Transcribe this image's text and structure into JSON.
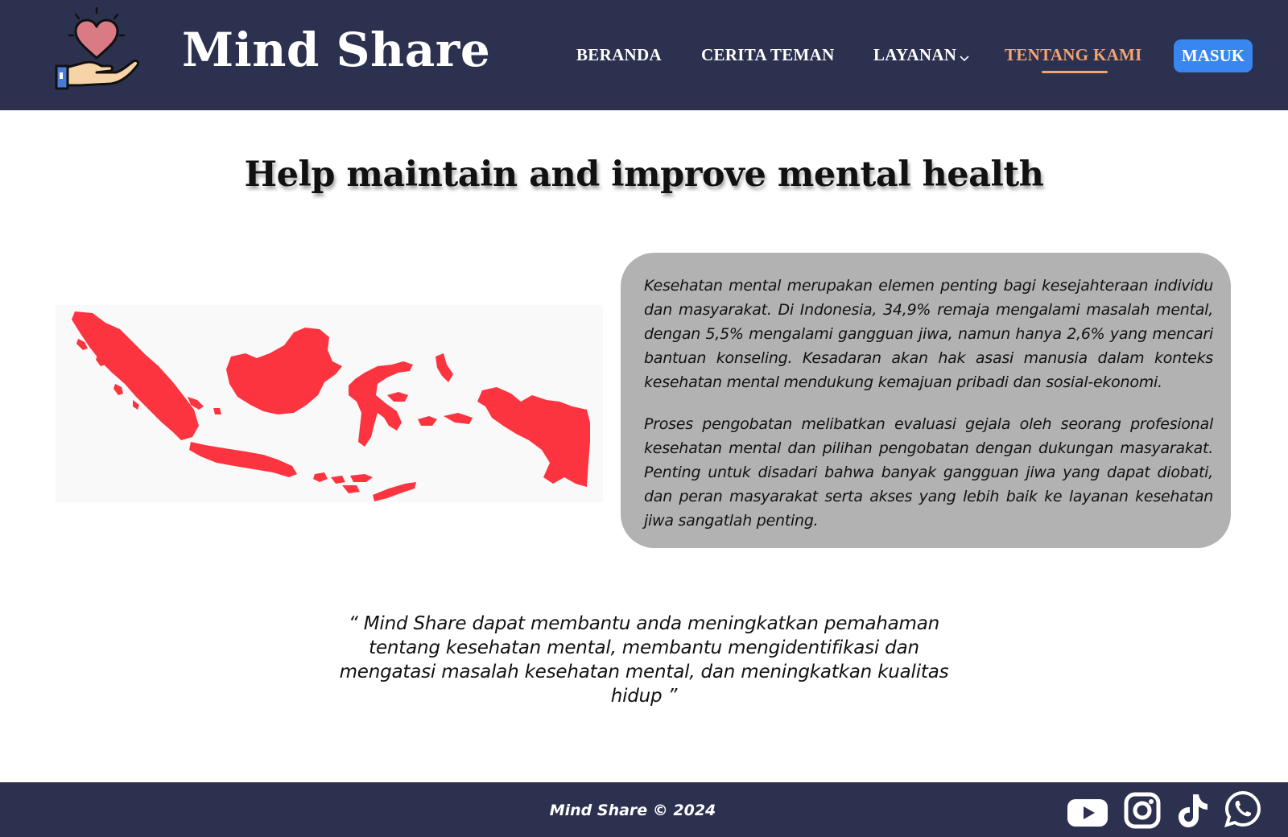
{
  "header": {
    "brand": "Mind Share",
    "nav": [
      {
        "label": "BERANDA"
      },
      {
        "label": "CERITA TEMAN"
      },
      {
        "label": "LAYANAN"
      },
      {
        "label": "TENTANG KAMI",
        "active": true
      }
    ],
    "login_label": "MASUK"
  },
  "main": {
    "title": "Help maintain and improve mental health",
    "paragraphs": [
      "Kesehatan mental merupakan elemen penting bagi kesejahteraan individu dan masyarakat. Di Indonesia, 34,9% remaja mengalami masalah mental, dengan 5,5% mengalami gangguan jiwa, namun hanya 2,6% yang mencari bantuan konseling. Kesadaran akan hak asasi manusia dalam konteks kesehatan mental mendukung kemajuan pribadi dan sosial-ekonomi.",
      "Proses pengobatan melibatkan evaluasi gejala oleh seorang profesional kesehatan mental dan pilihan pengobatan dengan dukungan masyarakat. Penting untuk disadari bahwa banyak gangguan jiwa yang dapat diobati, dan peran masyarakat serta akses yang lebih baik ke layanan kesehatan jiwa sangatlah penting."
    ],
    "quote": "“ Mind Share dapat membantu anda meningkatkan pemahaman tentang kesehatan mental, membantu mengidentifikasi dan mengatasi masalah kesehatan mental, dan meningkatkan kualitas hidup ”"
  },
  "footer": {
    "copyright": "Mind Share © 2024",
    "social": [
      "youtube-icon",
      "instagram-icon",
      "tiktok-icon",
      "whatsapp-icon"
    ]
  },
  "colors": {
    "navy": "#2c3150",
    "accent_orange": "#f2a472",
    "button_blue": "#3a86f0",
    "map_red": "#fc3440",
    "card_gray": "#b2b2b2"
  }
}
